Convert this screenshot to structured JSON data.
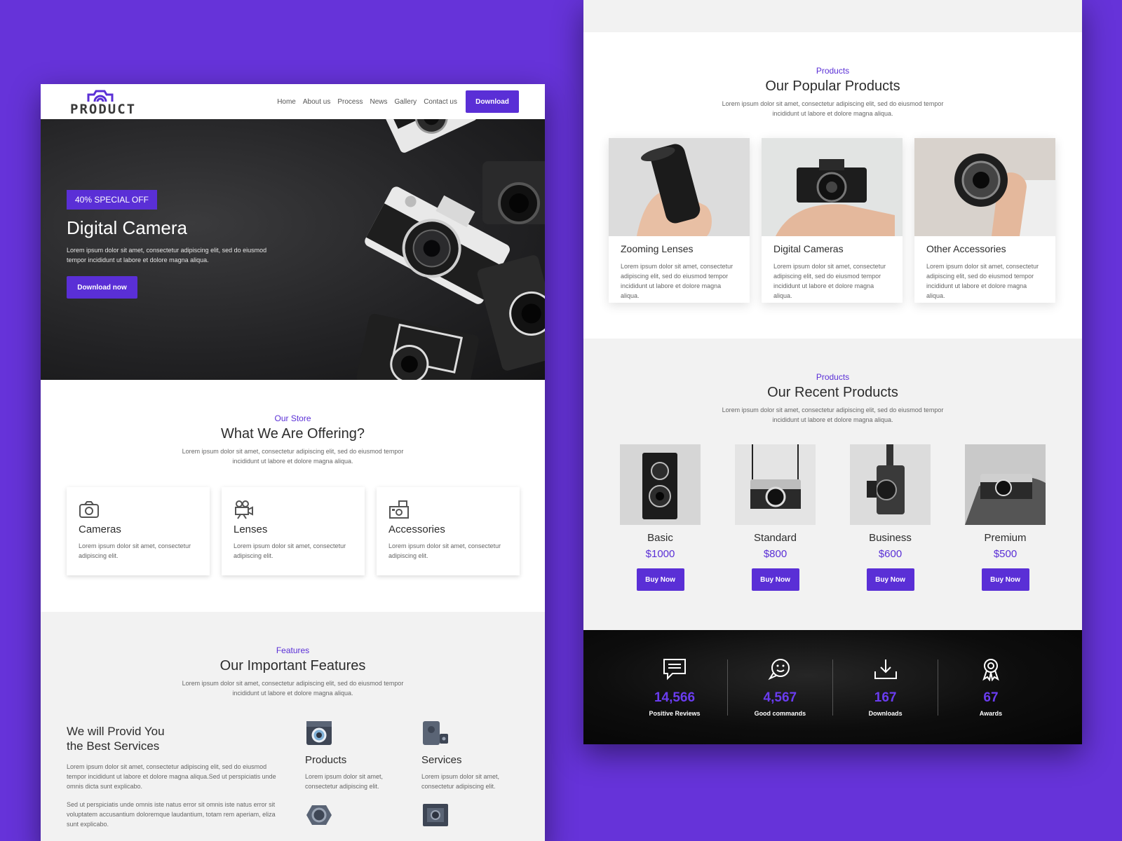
{
  "colors": {
    "accent": "#5a2fd6",
    "background": "#6633d9",
    "dark": "#1a1a1b",
    "light_gray": "#f2f2f2"
  },
  "left": {
    "logo_text": "PRODUCT",
    "nav": [
      "Home",
      "About us",
      "Process",
      "News",
      "Gallery",
      "Contact us"
    ],
    "nav_button": "Download",
    "hero": {
      "badge": "40% SPECIAL OFF",
      "title": "Digital Camera",
      "text": "Lorem ipsum dolor sit amet, consectetur adipiscing elit, sed do eiusmod tempor incididunt ut labore et dolore magna aliqua.",
      "button": "Download now"
    },
    "store": {
      "eyebrow": "Our Store",
      "title": "What We Are Offering?",
      "subtitle": "Lorem ipsum dolor sit amet, consectetur adipiscing elit, sed do eiusmod tempor incididunt ut labore et dolore magna aliqua.",
      "cards": [
        {
          "icon": "camera-icon",
          "title": "Cameras",
          "text": "Lorem ipsum dolor sit amet, consectetur adipiscing elit."
        },
        {
          "icon": "video-camera-icon",
          "title": "Lenses",
          "text": "Lorem ipsum dolor sit amet, consectetur adipiscing elit."
        },
        {
          "icon": "polaroid-icon",
          "title": "Accessories",
          "text": "Lorem ipsum dolor sit amet, consectetur adipiscing elit."
        }
      ]
    },
    "features": {
      "eyebrow": "Features",
      "title": "Our Important Features",
      "subtitle": "Lorem ipsum dolor sit amet, consectetur adipiscing elit, sed do eiusmod tempor incididunt ut labore et dolore magna aliqua.",
      "heading_line1": "We will Provid You",
      "heading_line2": "the Best Services",
      "para1": "Lorem ipsum dolor sit amet, consectetur adipiscing elit, sed do eiusmod tempor incididunt ut labore et dolore magna aliqua.Sed ut perspiciatis unde omnis dicta sunt explicabo.",
      "para2": "Sed ut perspiciatis unde omnis iste natus error sit omnis iste natus error sit voluptatem accusantium doloremque laudantium, totam rem aperiam, eliza sunt explicabo.",
      "items": [
        {
          "icon": "instant-camera-icon",
          "title": "Products",
          "text": "Lorem ipsum dolor sit amet, consectetur adipiscing elit."
        },
        {
          "icon": "speaker-icon",
          "title": "Services",
          "text": "Lorem ipsum dolor sit amet, consectetur adipiscing elit."
        }
      ]
    }
  },
  "right": {
    "popular": {
      "eyebrow": "Products",
      "title": "Our Popular Products",
      "subtitle": "Lorem ipsum dolor sit amet, consectetur adipiscing elit, sed do eiusmod tempor incididunt ut labore et dolore magna aliqua.",
      "cards": [
        {
          "title": "Zooming Lenses",
          "text": "Lorem ipsum dolor sit amet, consectetur adipiscing elit, sed do eiusmod tempor incididunt ut labore et dolore magna aliqua."
        },
        {
          "title": "Digital Cameras",
          "text": "Lorem ipsum dolor sit amet, consectetur adipiscing elit, sed do eiusmod tempor incididunt ut labore et dolore magna aliqua."
        },
        {
          "title": "Other Accessories",
          "text": "Lorem ipsum dolor sit amet, consectetur adipiscing elit, sed do eiusmod tempor incididunt ut labore et dolore magna aliqua."
        }
      ]
    },
    "recent": {
      "eyebrow": "Products",
      "title": "Our Recent Products",
      "subtitle": "Lorem ipsum dolor sit amet, consectetur adipiscing elit, sed do eiusmod tempor incididunt ut labore et dolore magna aliqua.",
      "items": [
        {
          "name": "Basic",
          "price": "$1000",
          "button": "Buy Now"
        },
        {
          "name": "Standard",
          "price": "$800",
          "button": "Buy Now"
        },
        {
          "name": "Business",
          "price": "$600",
          "button": "Buy Now"
        },
        {
          "name": "Premium",
          "price": "$500",
          "button": "Buy Now"
        }
      ]
    },
    "stats": [
      {
        "icon": "chat-icon",
        "value": "14,566",
        "label": "Positive Reviews"
      },
      {
        "icon": "smile-chat-icon",
        "value": "4,567",
        "label": "Good commands"
      },
      {
        "icon": "download-icon",
        "value": "167",
        "label": "Downloads"
      },
      {
        "icon": "award-icon",
        "value": "67",
        "label": "Awards"
      }
    ]
  }
}
